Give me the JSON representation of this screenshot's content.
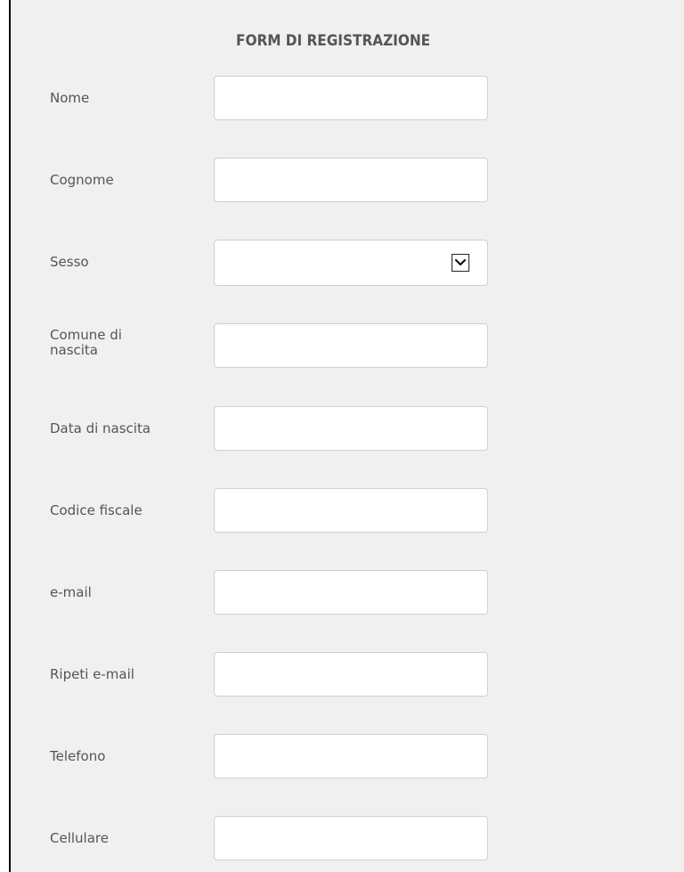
{
  "form": {
    "title": "FORM DI REGISTRAZIONE",
    "fields": [
      {
        "label": "Nome",
        "value": "",
        "type": "text"
      },
      {
        "label": "Cognome",
        "value": "",
        "type": "text"
      },
      {
        "label": "Sesso",
        "value": "",
        "type": "select"
      },
      {
        "label": "Comune di nascita",
        "value": "",
        "type": "text"
      },
      {
        "label": "Data di nascita",
        "value": "",
        "type": "text"
      },
      {
        "label": "Codice fiscale",
        "value": "",
        "type": "text"
      },
      {
        "label": "e-mail",
        "value": "",
        "type": "text"
      },
      {
        "label": "Ripeti e-mail",
        "value": "",
        "type": "text"
      },
      {
        "label": "Telefono",
        "value": "",
        "type": "text"
      },
      {
        "label": "Cellulare",
        "value": "",
        "type": "text"
      }
    ]
  },
  "icons": {
    "select_arrow": "chevron-down-icon"
  },
  "colors": {
    "background": "#f0f0f0",
    "label_text": "#555555",
    "input_border": "#cfcfcf"
  }
}
